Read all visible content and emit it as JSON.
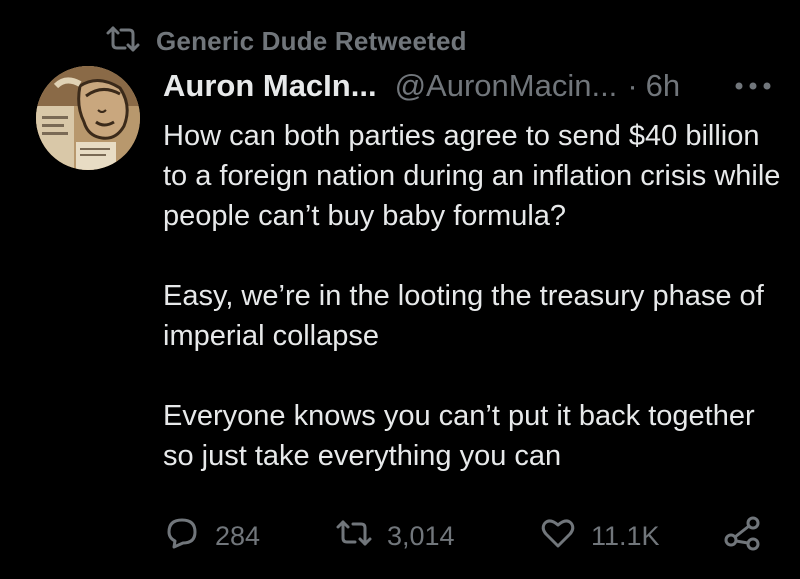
{
  "retweet_context": {
    "icon": "retweet-icon",
    "text": "Generic Dude Retweeted"
  },
  "tweet": {
    "author_name": "Auron MacIn...",
    "handle": "@AuronMacin...",
    "separator": "·",
    "time": "6h",
    "paragraphs": [
      "How can both parties agree to send $40 billion to a foreign nation during an inflation crisis while people can’t buy baby formula?",
      "Easy, we’re in the looting the treasury phase of imperial collapse",
      "Everyone knows you can’t put it back together so just take everything you can"
    ]
  },
  "actions": {
    "replies": "284",
    "retweets": "3,014",
    "likes": "11.1K"
  },
  "colors": {
    "background": "#000000",
    "text": "#e7e9ea",
    "secondary": "#71767b"
  }
}
